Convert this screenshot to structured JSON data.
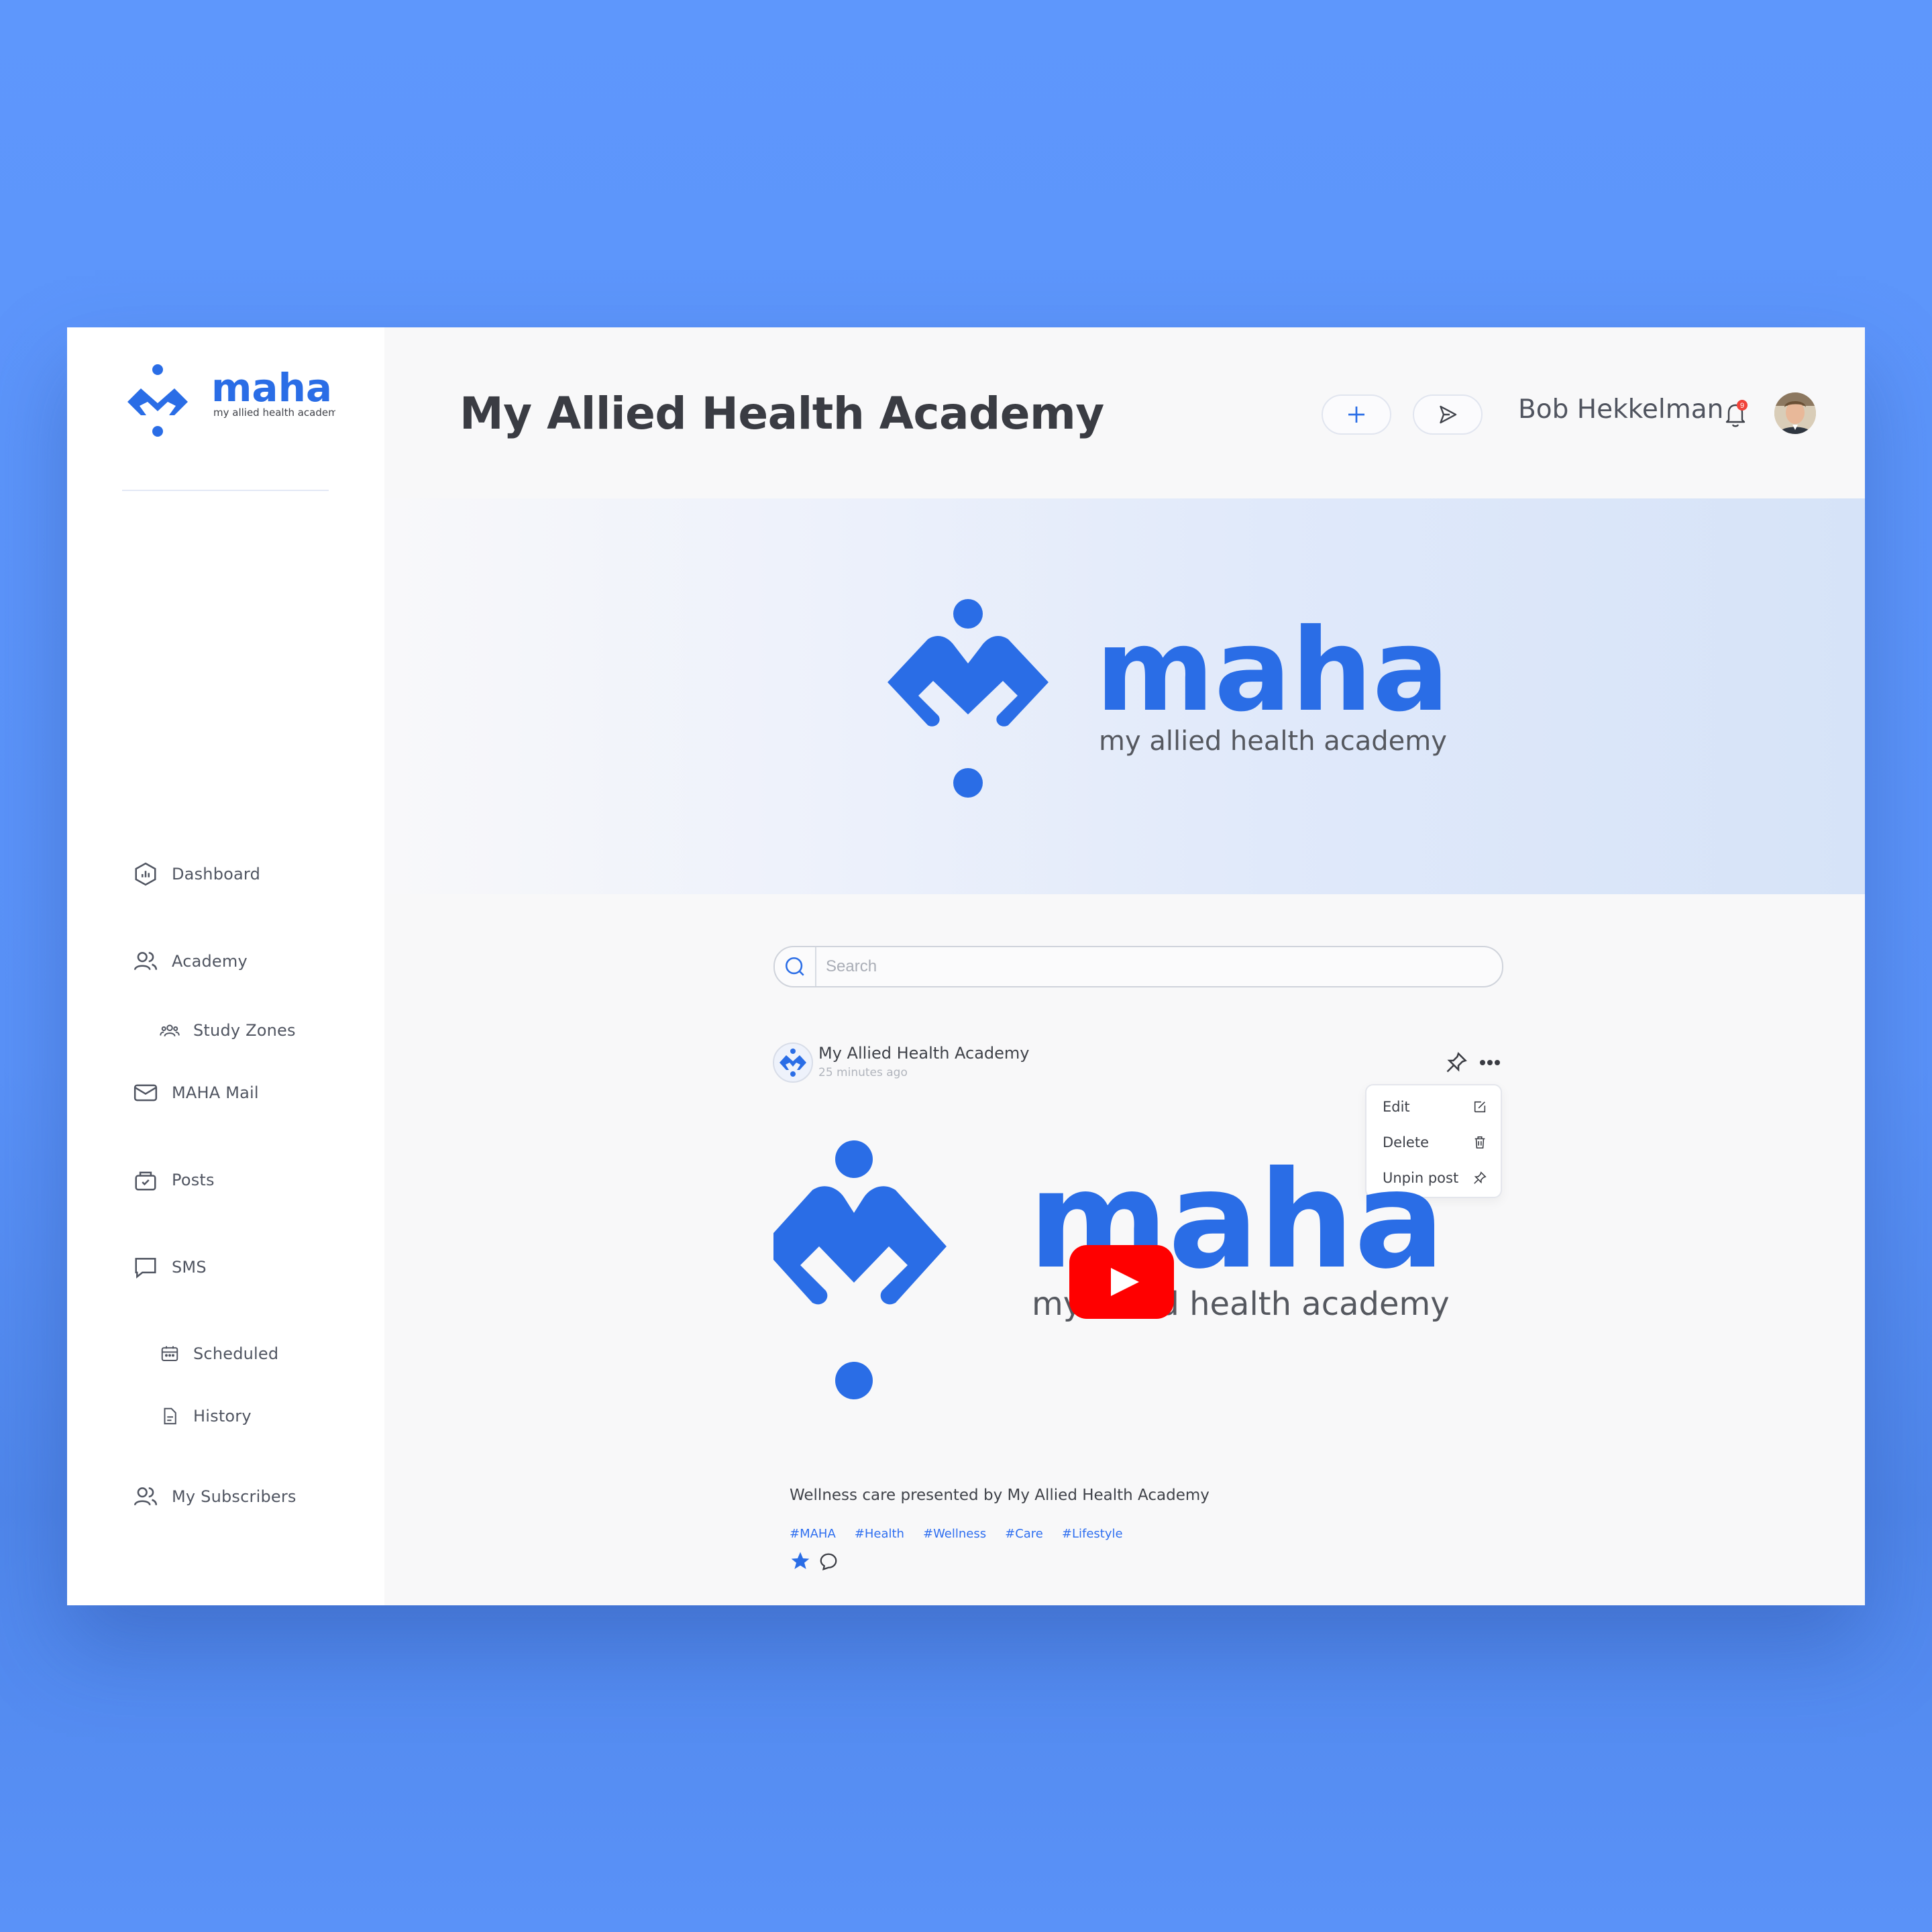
{
  "brand": {
    "name": "maha",
    "tagline": "my allied health academy"
  },
  "header": {
    "title": "My Allied Health Academy",
    "user_name": "Bob Hekkelman",
    "notification_count": "9"
  },
  "sidebar": {
    "items": [
      {
        "label": "Dashboard",
        "icon": "dashboard-icon"
      },
      {
        "label": "Academy",
        "icon": "users-icon"
      },
      {
        "label": "Study Zones",
        "icon": "group-icon"
      },
      {
        "label": "MAHA Mail",
        "icon": "mail-icon"
      },
      {
        "label": "Posts",
        "icon": "bag-icon"
      },
      {
        "label": "SMS",
        "icon": "chat-icon"
      },
      {
        "label": "Scheduled",
        "icon": "calendar-icon"
      },
      {
        "label": "History",
        "icon": "document-icon"
      },
      {
        "label": "My Subscribers",
        "icon": "users-icon"
      }
    ]
  },
  "search": {
    "placeholder": "Search",
    "value": ""
  },
  "post": {
    "author": "My Allied Health Academy",
    "time": "25 minutes ago",
    "caption": "Wellness care presented by My Allied Health Academy",
    "tags": [
      "#MAHA",
      "#Health",
      "#Wellness",
      "#Care",
      "#Lifestyle"
    ],
    "menu": {
      "edit": "Edit",
      "delete": "Delete",
      "unpin": "Unpin post"
    }
  },
  "colors": {
    "background": "#5e97fc",
    "brand_blue": "#2a6de6",
    "text_dark": "#3a3c43",
    "tag_blue": "#2f6ff0",
    "youtube_red": "#ff0000",
    "notification_red": "#f0433a"
  }
}
